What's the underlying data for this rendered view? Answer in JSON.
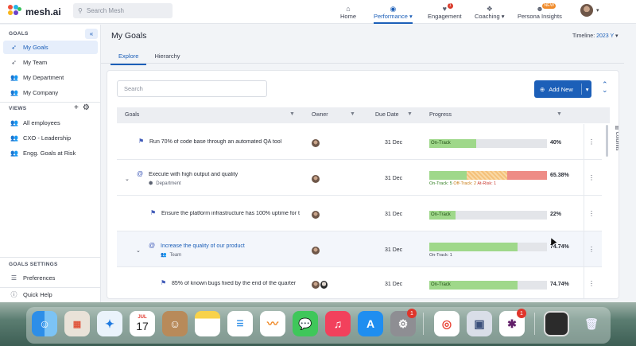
{
  "topbar": {
    "brand": "mesh.ai",
    "search_placeholder": "Search Mesh",
    "nav": [
      {
        "label": "Home",
        "icon": "home-icon"
      },
      {
        "label": "Performance",
        "icon": "gauge-icon",
        "active": true
      },
      {
        "label": "Engagement",
        "icon": "heart-icon",
        "badge": "1"
      },
      {
        "label": "Coaching",
        "icon": "coach-icon"
      },
      {
        "label": "Persona Insights",
        "icon": "persona-icon",
        "badge": "NEW"
      }
    ]
  },
  "sidebar": {
    "goals_title": "GOALS",
    "goals_items": [
      "My Goals",
      "My Team",
      "My Department",
      "My Company"
    ],
    "views_title": "VIEWS",
    "views_items": [
      "All employees",
      "CXO - Leadership",
      "Engg. Goals at Risk"
    ],
    "settings_title": "GOALS SETTINGS",
    "settings_items": [
      "Preferences"
    ],
    "help": "Quick Help"
  },
  "main": {
    "title": "My Goals",
    "timeline_label": "Timeline:",
    "timeline_value": "2023 Y",
    "tabs": [
      "Explore",
      "Hierarchy"
    ]
  },
  "grid": {
    "search_placeholder": "Search",
    "add_button": "Add New",
    "columns_label": "Columns",
    "headers": {
      "goals": "Goals",
      "owner": "Owner",
      "due": "Due Date",
      "progress": "Progress"
    },
    "rows": [
      {
        "title": "Run 70% of code base through an automated QA tool",
        "due": "31 Dec",
        "status": "On-Track",
        "pct": "40%",
        "fill": 0.4
      },
      {
        "title": "Execute with high output and quality",
        "sub": "Department",
        "due": "31 Dec",
        "pct": "65.38%",
        "legend": {
          "on": "On-Track: 5",
          "off": "Off-Track: 2",
          "risk": "At-Risk: 1"
        }
      },
      {
        "title": "Ensure the platform infrastructure has 100% uptime for t",
        "due": "31 Dec",
        "status": "On-Track",
        "pct": "22%",
        "fill": 0.22
      },
      {
        "title": "Increase the quality of our product",
        "sub": "Team",
        "due": "31 Dec",
        "pct": "74.74%",
        "legend_single": "On-Track: 1",
        "fill": 0.7474
      },
      {
        "title": "85% of known bugs fixed by the end of the quarter",
        "due": "31 Dec",
        "status": "On-Track",
        "pct": "74.74%",
        "fill": 0.7474
      }
    ]
  },
  "dock": {
    "calendar_month": "JUL",
    "calendar_day": "17",
    "badges": [
      "1",
      "1"
    ]
  },
  "colors": {
    "accent": "#1c5fb8",
    "on_track": "#9fd88a",
    "off_track": "#f5c17a",
    "at_risk": "#ee8c86"
  }
}
